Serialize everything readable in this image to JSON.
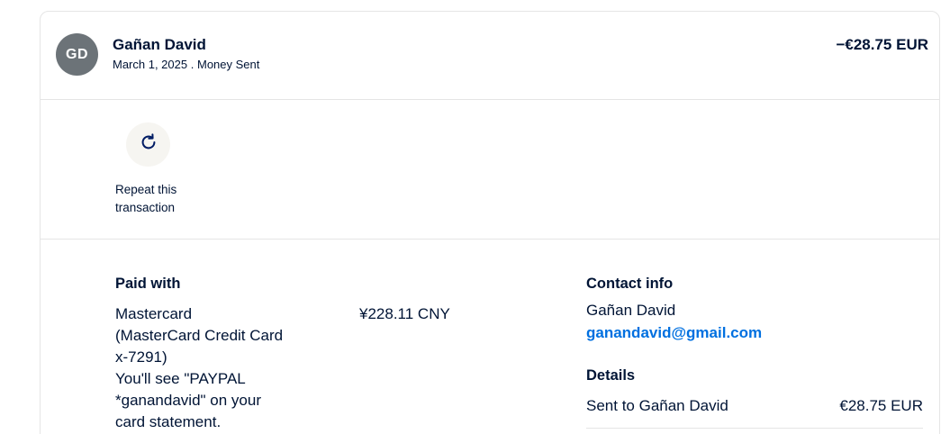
{
  "transaction": {
    "avatar_initials": "GD",
    "name": "Gañan David",
    "date": "March 1, 2025",
    "separator": ".",
    "type": "Money Sent",
    "amount": "−€28.75 EUR"
  },
  "actions": {
    "repeat_label": "Repeat this transaction",
    "repeat_icon": "refresh-icon"
  },
  "paid_with": {
    "title": "Paid with",
    "method_line1": "Mastercard",
    "method_line2": "(MasterCard Credit Card",
    "method_line3": "x-7291)",
    "statement_line1": "You'll see \"PAYPAL",
    "statement_line2": "*ganandavid\" on your",
    "statement_line3": "card statement.",
    "charged_amount": "¥228.11 CNY"
  },
  "contact": {
    "title": "Contact info",
    "name": "Gañan David",
    "email": "ganandavid@gmail.com"
  },
  "details": {
    "title": "Details",
    "row_label": "Sent to Gañan David",
    "row_value": "€28.75 EUR"
  },
  "colors": {
    "text": "#001435",
    "link": "#0070e0",
    "avatar_bg": "#6c7378",
    "button_bg": "#f6f5f1",
    "border": "#e5e5e5"
  }
}
